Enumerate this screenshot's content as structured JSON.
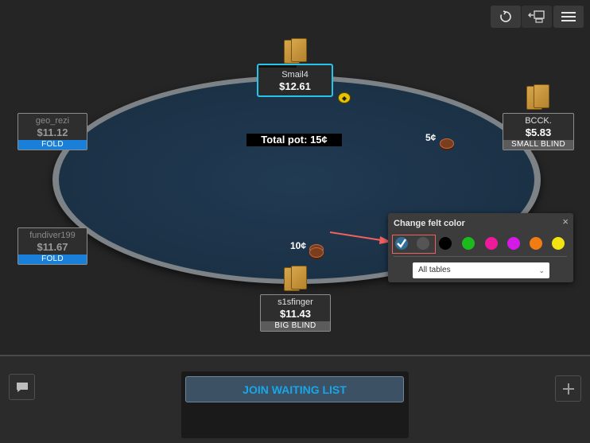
{
  "toolbar": {
    "buttons": [
      {
        "name": "rebuy-refresh-icon"
      },
      {
        "name": "leave-seat-icon"
      },
      {
        "name": "menu-icon"
      }
    ]
  },
  "table": {
    "total_pot_label": "Total pot: 15¢",
    "felt_color": "#1b3146"
  },
  "seats": {
    "top": {
      "name": "Smail4",
      "stack": "$12.61",
      "tag": ""
    },
    "top_right": {
      "name": "BCCK.",
      "stack": "$5.83",
      "tag": "SMALL BLIND"
    },
    "left_upper": {
      "name": "geo_rezi",
      "stack": "$11.12",
      "tag": "FOLD"
    },
    "left_lower": {
      "name": "fundiver199",
      "stack": "$11.67",
      "tag": "FOLD"
    },
    "bottom": {
      "name": "s1sfinger",
      "stack": "$11.43",
      "tag": "BIG BLIND"
    }
  },
  "bets": {
    "small_blind": "5¢",
    "big_blind": "10¢"
  },
  "felt_popup": {
    "title": "Change felt color",
    "close": "×",
    "selected_index": 0,
    "swatches": [
      "#2f6f9a",
      "#555555",
      "#000000",
      "#1dba1d",
      "#ee1a9c",
      "#d31ae6",
      "#f27b14",
      "#f4e312"
    ],
    "scope_select": "All tables"
  },
  "bottom": {
    "join_label": "JOIN WAITING LIST"
  },
  "colors": {
    "accent": "#19a6e8",
    "active_border": "#27c3ea",
    "fold_tag": "#1a7fd8"
  }
}
